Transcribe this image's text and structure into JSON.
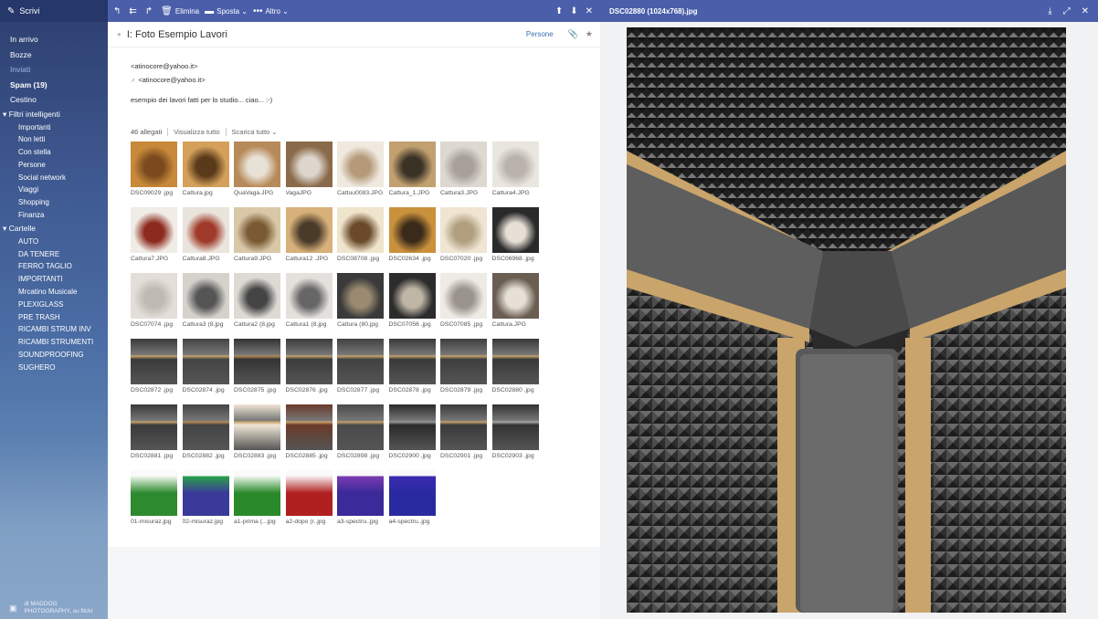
{
  "sidebar": {
    "compose_label": "Scrivi",
    "folders": [
      {
        "label": "In arrivo"
      },
      {
        "label": "Bozze"
      },
      {
        "label": "Inviati"
      },
      {
        "label": "Spam (19)"
      },
      {
        "label": "Cestino"
      }
    ],
    "smart_filters_label": "Filtri intelligenti",
    "smart_filters": [
      "Importanti",
      "Non letti",
      "Con stella",
      "Persone",
      "Social network",
      "Viaggi",
      "Shopping",
      "Finanza"
    ],
    "folders_label": "Cartelle",
    "custom_folders": [
      "AUTO",
      "DA TENERE",
      "FERRO TAGLIO",
      "IMPORTANTI",
      "Mrcatino Musicale",
      "PLEXIGLASS",
      "PRE TRASH",
      "RICAMBI STRUM INV",
      "RICAMBI STRUMENTI",
      "SOUNDPROOFING",
      "SUGHERO"
    ],
    "footer_line1": "di MADDOG",
    "footer_line2": "PHOTOGRAPHY, su flickr"
  },
  "toolbar": {
    "delete_label": "Elimina",
    "move_label": "Sposta",
    "more_label": "Altro"
  },
  "message": {
    "subject": "I: Foto Esempio Lavori",
    "people_label": "Persone",
    "from": "<atinocore@yahoo.it>",
    "to": "<atinocore@yahoo.it>",
    "body": "esempio dei lavori fatti per lo studio... ciao... :-)",
    "attachments_count": "46 allegati",
    "view_all": "Visualizza tutto",
    "download_all": "Scarica tutto"
  },
  "attachments": [
    "DSC09029 .jpg",
    "Cattura.jpg",
    "QuaVaga.JPG",
    "VagaJPG",
    "Cattuu0083.JPG",
    "Cattura_1.JPG",
    "Cattura3.JPG",
    "Cattura4.JPG",
    "Cattura7.JPG",
    "Cattura8.JPG",
    "Cattura9.JPG",
    "Cattura12 .JPG",
    "DSC08708 .jpg",
    "DSC02634 .jpg",
    "DSC07020 .jpg",
    "DSC06968 .jpg",
    "DSC07074 .jpg",
    "Cattura3 (8.jpg",
    "Cattura2 (8.jpg",
    "Cattura1 (8.jpg",
    "Cattura (80.jpg",
    "DSC07056 .jpg",
    "DSC07085 .jpg",
    "Cattura.JPG",
    "DSC02872 .jpg",
    "DSC02874 .jpg",
    "DSC02875 .jpg",
    "DSC02876 .jpg",
    "DSC02877 .jpg",
    "DSC02878 .jpg",
    "DSC02879 .jpg",
    "DSC02880 .jpg",
    "DSC02881 .jpg",
    "DSC02882 .jpg",
    "DSC02883 .jpg",
    "DSC02885 .jpg",
    "DSC02898 .jpg",
    "DSC02900 .jpg",
    "DSC02901 .jpg",
    "DSC02903 .jpg",
    "01-misuraz.jpg",
    "02-misuraz.jpg",
    "a1-prima (...jpg",
    "a2-dopo (r..jpg",
    "a3-spectru..jpg",
    "a4-spectru..jpg"
  ],
  "preview": {
    "title": "DSC02880 (1024x768).jpg"
  },
  "colors": {
    "toolbar": "#4a5eaa",
    "link": "#3c6fb8"
  }
}
